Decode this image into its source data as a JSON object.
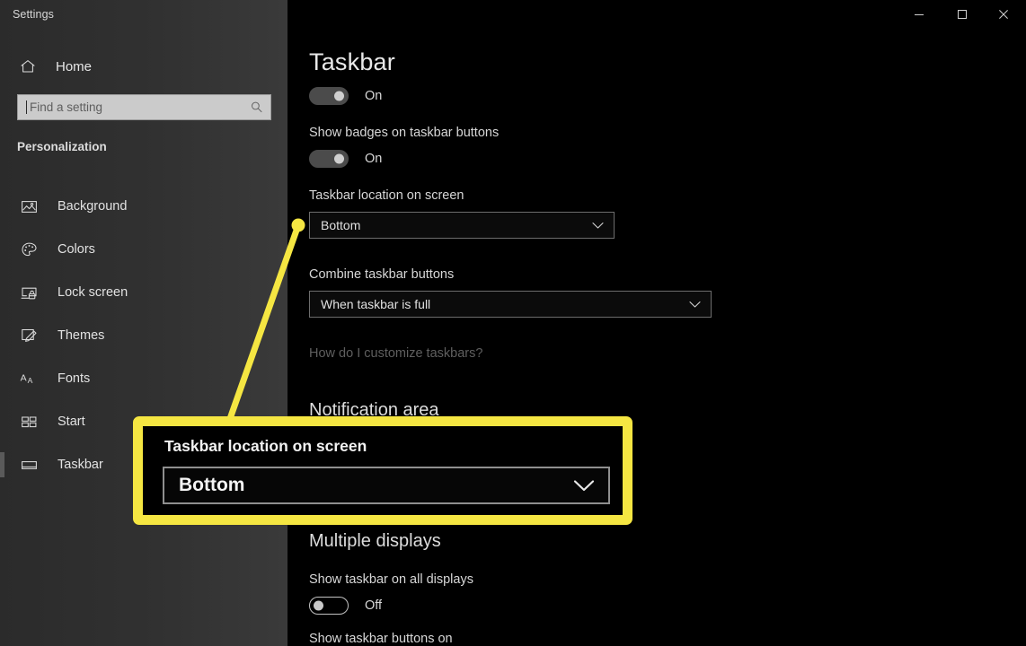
{
  "window": {
    "title": "Settings",
    "controls": [
      {
        "name": "minimize",
        "glyph": "minimize-icon"
      },
      {
        "name": "maximize",
        "glyph": "maximize-icon"
      },
      {
        "name": "close",
        "glyph": "close-icon"
      }
    ]
  },
  "sidebar": {
    "home": {
      "label": "Home",
      "icon": "home-icon"
    },
    "search": {
      "value": "",
      "placeholder": "Find a setting",
      "icon": "search-icon"
    },
    "section": "Personalization",
    "items": [
      {
        "label": "Background",
        "icon": "image-icon",
        "selected": false
      },
      {
        "label": "Colors",
        "icon": "palette-icon",
        "selected": false
      },
      {
        "label": "Lock screen",
        "icon": "lock-screen-icon",
        "selected": false
      },
      {
        "label": "Themes",
        "icon": "themes-icon",
        "selected": false
      },
      {
        "label": "Fonts",
        "icon": "fonts-icon",
        "selected": false
      },
      {
        "label": "Start",
        "icon": "start-icon",
        "selected": false
      },
      {
        "label": "Taskbar",
        "icon": "taskbar-icon",
        "selected": true
      }
    ]
  },
  "main": {
    "title": "Taskbar",
    "lock_taskbar_toggle": {
      "state": "On"
    },
    "show_badges": {
      "label": "Show badges on taskbar buttons",
      "state": "On"
    },
    "taskbar_location": {
      "label": "Taskbar location on screen",
      "value": "Bottom"
    },
    "combine_buttons": {
      "label": "Combine taskbar buttons",
      "value": "When taskbar is full"
    },
    "help_link": "How do I customize taskbars?",
    "notification_area_heading": "Notification area",
    "multiple_displays_heading": "Multiple displays",
    "show_on_all_displays": {
      "label": "Show taskbar on all displays",
      "state": "Off"
    },
    "show_buttons_on": {
      "label": "Show taskbar buttons on"
    }
  },
  "annotation": {
    "color": "#f5e642",
    "callout": {
      "label": "Taskbar location on screen",
      "value": "Bottom"
    }
  }
}
